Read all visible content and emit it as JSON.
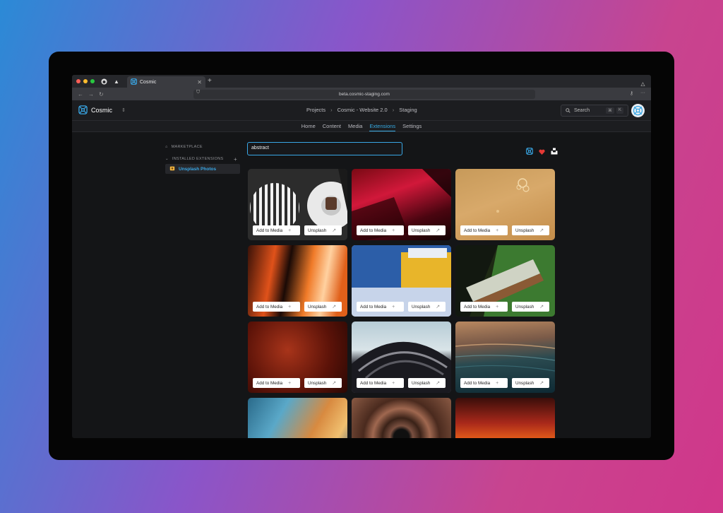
{
  "browser": {
    "tab_title": "Cosmic",
    "url": "beta.cosmic-staging.com"
  },
  "app": {
    "brand": "Cosmic",
    "breadcrumb": [
      "Projects",
      "Cosmic - Website 2.0",
      "Staging"
    ],
    "search_label": "Search",
    "shortcut": [
      "⌘",
      "K"
    ]
  },
  "nav": {
    "tabs": [
      "Home",
      "Content",
      "Media",
      "Extensions",
      "Settings"
    ],
    "active": "Extensions"
  },
  "sidebar": {
    "marketplace": "MARKETPLACE",
    "installed": "INSTALLED EXTENSIONS",
    "active_item": "Unsplash Photos"
  },
  "search": {
    "value": "abstract"
  },
  "card_actions": {
    "add": "Add to Media",
    "unsplash": "Unsplash"
  },
  "colors": {
    "accent": "#39a7e6",
    "heart": "#e53935"
  },
  "photos": [
    {
      "alt": "abstract-photo-1"
    },
    {
      "alt": "abstract-photo-2"
    },
    {
      "alt": "abstract-photo-3"
    },
    {
      "alt": "abstract-photo-4"
    },
    {
      "alt": "abstract-photo-5"
    },
    {
      "alt": "abstract-photo-6"
    },
    {
      "alt": "abstract-photo-7"
    },
    {
      "alt": "abstract-photo-8"
    },
    {
      "alt": "abstract-photo-9"
    },
    {
      "alt": "abstract-photo-10"
    },
    {
      "alt": "abstract-photo-11"
    },
    {
      "alt": "abstract-photo-12"
    }
  ]
}
